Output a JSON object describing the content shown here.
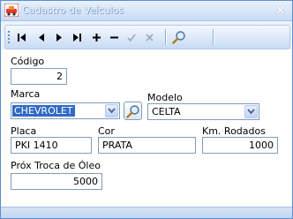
{
  "window": {
    "title": "Cadastro de Veículos",
    "close_glyph": "×"
  },
  "toolbar": {
    "buttons": [
      {
        "name": "first-record-icon"
      },
      {
        "name": "prior-record-icon"
      },
      {
        "name": "next-record-icon"
      },
      {
        "name": "last-record-icon"
      },
      {
        "name": "insert-record-icon"
      },
      {
        "name": "delete-record-icon"
      },
      {
        "name": "post-check-icon"
      },
      {
        "name": "cancel-x-icon"
      },
      {
        "name": "search-icon"
      }
    ]
  },
  "form": {
    "codigo": {
      "label": "Código",
      "value": "2"
    },
    "marca": {
      "label": "Marca",
      "value": "CHEVROLET"
    },
    "modelo": {
      "label": "Modelo",
      "value": "CELTA"
    },
    "placa": {
      "label": "Placa",
      "value": "PKI 1410"
    },
    "cor": {
      "label": "Cor",
      "value": "PRATA"
    },
    "km": {
      "label": "Km. Rodados",
      "value": "1000"
    },
    "troca_oleo": {
      "label": "Próx Troca de Óleo",
      "value": "5000"
    }
  },
  "colors": {
    "selection": "#316ac5",
    "border": "#7f9db9",
    "toolbar_top": "#f4f8fe",
    "toolbar_bottom": "#c8dbf4"
  }
}
